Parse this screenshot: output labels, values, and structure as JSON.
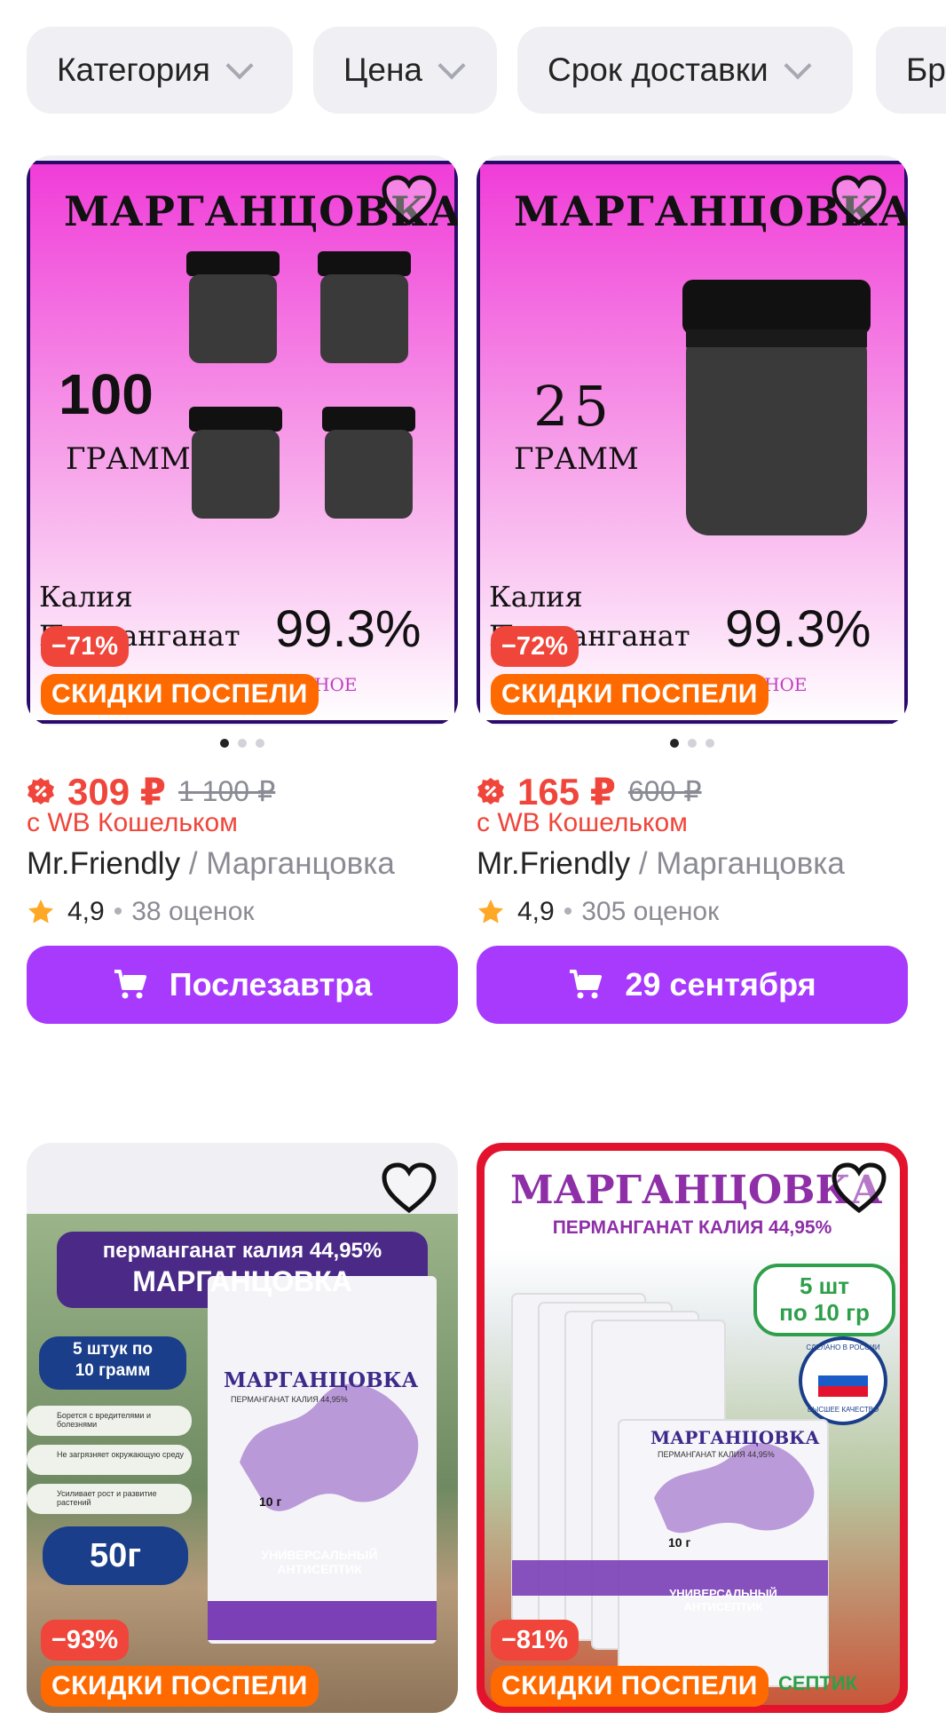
{
  "filters": [
    {
      "label": "Категория"
    },
    {
      "label": "Цена"
    },
    {
      "label": "Срок доставки"
    },
    {
      "label": "Бр"
    }
  ],
  "colors": {
    "accent": "#a73afd",
    "price": "#f0453a",
    "promo": "#ff6a00",
    "chip_bg": "#f0f0f4"
  },
  "products": [
    {
      "image": {
        "title": "МАРГАНЦОВКА",
        "amount": "100",
        "unit": "ГРАММ",
        "line1": "Калия",
        "line2": "Перманганат",
        "percent": "99.3%",
        "footer": "ЭФФЕКТИВНОЕ СРЕДСТВО"
      },
      "discount": "−71%",
      "promo": "СКИДКИ ПОСПЕЛИ",
      "price": "309 ₽",
      "old_price": "1 100 ₽",
      "wallet": "с WB Кошельком",
      "brand": "Mr.Friendly",
      "sep": " / ",
      "name": "Марганцовка",
      "rating": "4,9",
      "reviews": "38 оценок",
      "delivery": "Послезавтра"
    },
    {
      "image": {
        "title": "МАРГАНЦОВКА",
        "amount": "25",
        "unit": "ГРАММ",
        "line1": "Калия",
        "line2": "Перманганат",
        "percent": "99.3%",
        "footer": "ЭФФЕКТИВНОЕ СРЕДСТВО"
      },
      "discount": "−72%",
      "promo": "СКИДКИ ПОСПЕЛИ",
      "price": "165 ₽",
      "old_price": "600 ₽",
      "wallet": "с WB Кошельком",
      "brand": "Mr.Friendly",
      "sep": " / ",
      "name": "Марганцовка",
      "rating": "4,9",
      "reviews": "305 оценок",
      "delivery": "29 сентября"
    },
    {
      "image": {
        "banner1": "перманганат калия 44,95%",
        "banner2": "МАРГАНЦОВКА",
        "pack": "5 штук по",
        "pack2": "10 грамм",
        "f1": "Борется с вредителями и болезнями",
        "f2": "Не загрязняет окружающую среду",
        "f3": "Усиливает рост и развитие растений",
        "weight": "50г",
        "sachet_title": "МАРГАНЦОВКА",
        "sachet_sub": "ПЕРМАНГАНАТ КАЛИЯ 44,95%",
        "sachet_g": "10 г",
        "sachet_bottom": "УНИВЕРСАЛЬНЫЙ АНТИСЕПТИК"
      },
      "discount": "−93%",
      "promo": "СКИДКИ ПОСПЕЛИ"
    },
    {
      "image": {
        "title": "МАРГАНЦОВКА",
        "sub": "ПЕРМАНГАНАТ КАЛИЯ 44,95%",
        "pack": "5 шт",
        "pack2": "по 10 гр",
        "seal1": "СДЕЛАНО В РОССИИ",
        "seal2": "ВЫСШЕЕ КАЧЕСТВО",
        "sachet_title": "МАРГАНЦОВКА",
        "sachet_sub": "ПЕРМАНГАНАТ КАЛИЯ 44,95%",
        "sachet_g": "10 г",
        "sachet_bottom": "УНИВЕРСАЛЬНЫЙ АНТИСЕПТИК",
        "tail": "СЕПТИК"
      },
      "discount": "−81%",
      "promo": "СКИДКИ ПОСПЕЛИ"
    }
  ]
}
